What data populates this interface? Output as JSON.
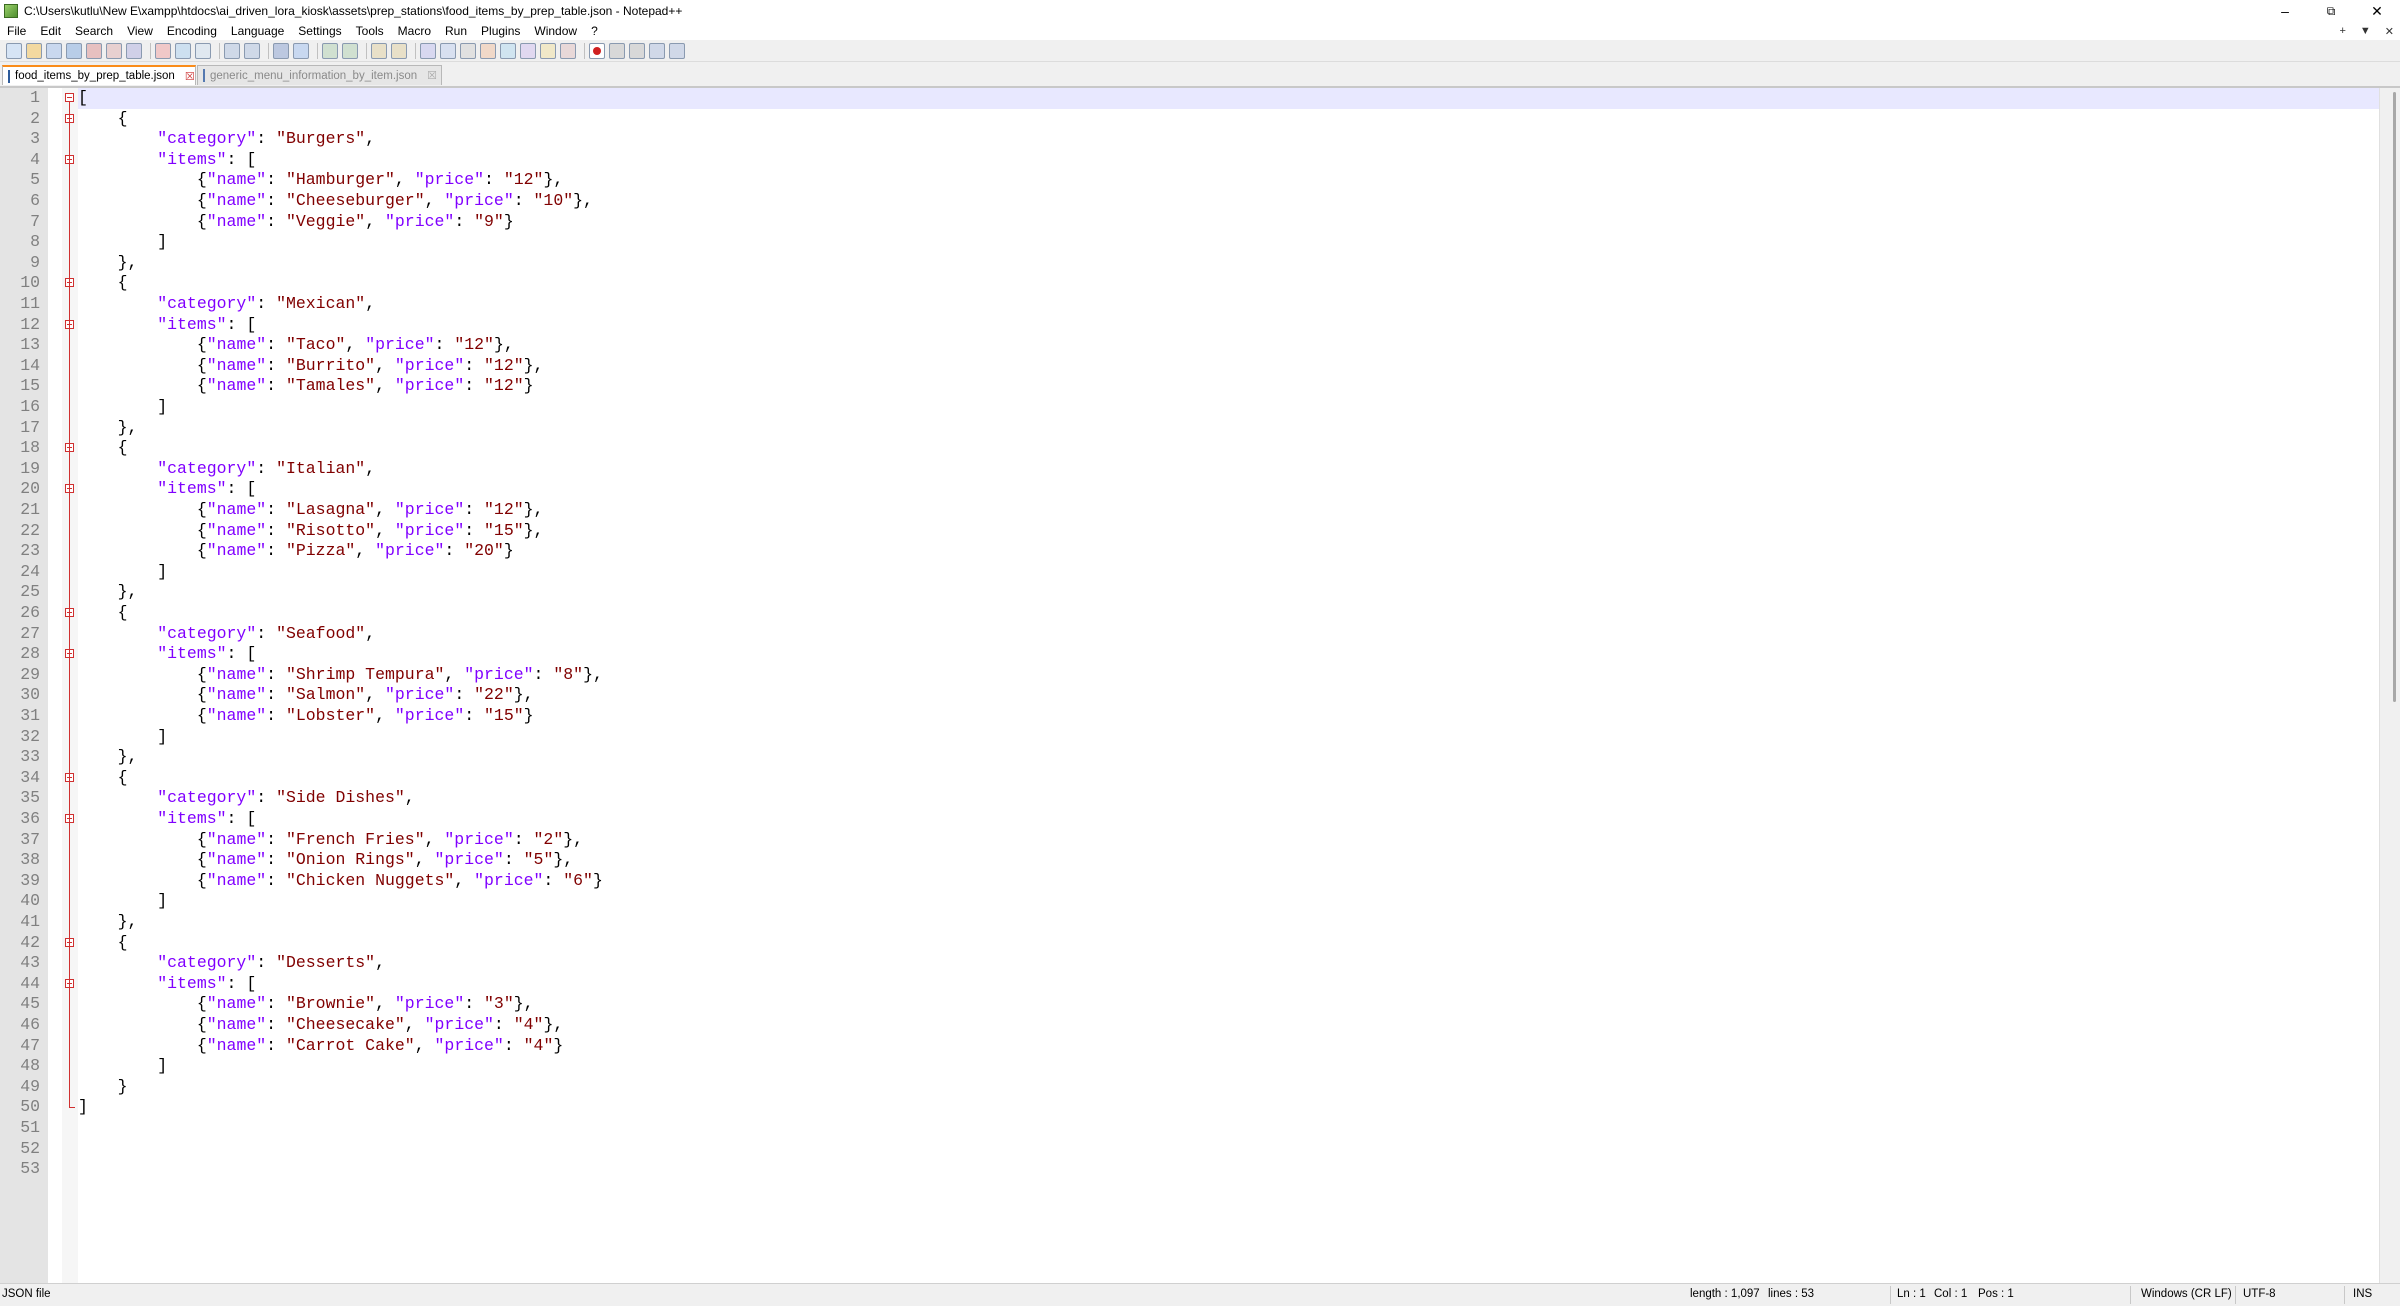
{
  "window": {
    "title": "C:\\Users\\kutlu\\New E\\xampp\\htdocs\\ai_driven_lora_kiosk\\assets\\prep_stations\\food_items_by_prep_table.json - Notepad++",
    "minimize_icon": "minimize-icon",
    "restore_icon": "restore-icon",
    "close_icon": "close-icon"
  },
  "menu": {
    "items": [
      "File",
      "Edit",
      "Search",
      "View",
      "Encoding",
      "Language",
      "Settings",
      "Tools",
      "Macro",
      "Run",
      "Plugins",
      "Window",
      "?"
    ],
    "right_icons": [
      "plus-icon",
      "dropdown-icon",
      "close-icon"
    ]
  },
  "toolbar": {
    "icons": [
      "new-file-icon",
      "open-file-icon",
      "save-icon",
      "save-all-icon",
      "close-icon",
      "close-all-icon",
      "print-icon",
      "cut-icon",
      "copy-icon",
      "paste-icon",
      "undo-icon",
      "redo-icon",
      "find-icon",
      "replace-icon",
      "zoom-in-icon",
      "zoom-out-icon",
      "sync-vertical-icon",
      "sync-horizontal-icon",
      "word-wrap-icon",
      "show-all-chars-icon",
      "indent-guide-icon",
      "user-language-icon",
      "document-map-icon",
      "function-list-icon",
      "folder-workspace-icon",
      "monitoring-icon",
      "record-macro-icon",
      "stop-macro-icon",
      "play-macro-icon",
      "run-macro-multiple-icon",
      "save-macro-icon"
    ]
  },
  "tabs": [
    {
      "label": "food_items_by_prep_table.json",
      "active": true
    },
    {
      "label": "generic_menu_information_by_item.json",
      "active": false
    }
  ],
  "editor": {
    "line_numbers": [
      "1",
      "2",
      "3",
      "4",
      "5",
      "6",
      "7",
      "8",
      "9",
      "10",
      "11",
      "12",
      "13",
      "14",
      "15",
      "16",
      "17",
      "18",
      "19",
      "20",
      "21",
      "22",
      "23",
      "24",
      "25",
      "26",
      "27",
      "28",
      "29",
      "30",
      "31",
      "32",
      "33",
      "34",
      "35",
      "36",
      "37",
      "38",
      "39",
      "40",
      "41",
      "42",
      "43",
      "44",
      "45",
      "46",
      "47",
      "48",
      "49",
      "50",
      "51",
      "52",
      "53"
    ],
    "lines": [
      "[",
      "    {",
      "        \"category\": \"Burgers\",",
      "        \"items\": [",
      "            {\"name\": \"Hamburger\", \"price\": \"12\"},",
      "            {\"name\": \"Cheeseburger\", \"price\": \"10\"},",
      "            {\"name\": \"Veggie\", \"price\": \"9\"}",
      "        ]",
      "    },",
      "    {",
      "        \"category\": \"Mexican\",",
      "        \"items\": [",
      "            {\"name\": \"Taco\", \"price\": \"12\"},",
      "            {\"name\": \"Burrito\", \"price\": \"12\"},",
      "            {\"name\": \"Tamales\", \"price\": \"12\"}",
      "        ]",
      "    },",
      "    {",
      "        \"category\": \"Italian\",",
      "        \"items\": [",
      "            {\"name\": \"Lasagna\", \"price\": \"12\"},",
      "            {\"name\": \"Risotto\", \"price\": \"15\"},",
      "            {\"name\": \"Pizza\", \"price\": \"20\"}",
      "        ]",
      "    },",
      "    {",
      "        \"category\": \"Seafood\",",
      "        \"items\": [",
      "            {\"name\": \"Shrimp Tempura\", \"price\": \"8\"},",
      "            {\"name\": \"Salmon\", \"price\": \"22\"},",
      "            {\"name\": \"Lobster\", \"price\": \"15\"}",
      "        ]",
      "    },",
      "    {",
      "        \"category\": \"Side Dishes\",",
      "        \"items\": [",
      "            {\"name\": \"French Fries\", \"price\": \"2\"},",
      "            {\"name\": \"Onion Rings\", \"price\": \"5\"},",
      "            {\"name\": \"Chicken Nuggets\", \"price\": \"6\"}",
      "        ]",
      "    },",
      "    {",
      "        \"category\": \"Desserts\",",
      "        \"items\": [",
      "            {\"name\": \"Brownie\", \"price\": \"3\"},",
      "            {\"name\": \"Cheesecake\", \"price\": \"4\"},",
      "            {\"name\": \"Carrot Cake\", \"price\": \"4\"}",
      "        ]",
      "    }",
      "]",
      "",
      "",
      ""
    ],
    "fold_open_lines": [
      1,
      2,
      4,
      10,
      12,
      18,
      20,
      26,
      28,
      34,
      36,
      42,
      44
    ],
    "colors": {
      "key": "#8000ff",
      "string": "#800000",
      "punct": "#000000",
      "fold": "#d03030",
      "current_line": "#e8e8ff"
    }
  },
  "status": {
    "file_type": "JSON file",
    "length": "length : 1,097",
    "lines": "lines : 53",
    "ln": "Ln : 1",
    "col": "Col : 1",
    "pos": "Pos : 1",
    "eol": "Windows (CR LF)",
    "encoding": "UTF-8",
    "mode": "INS"
  }
}
